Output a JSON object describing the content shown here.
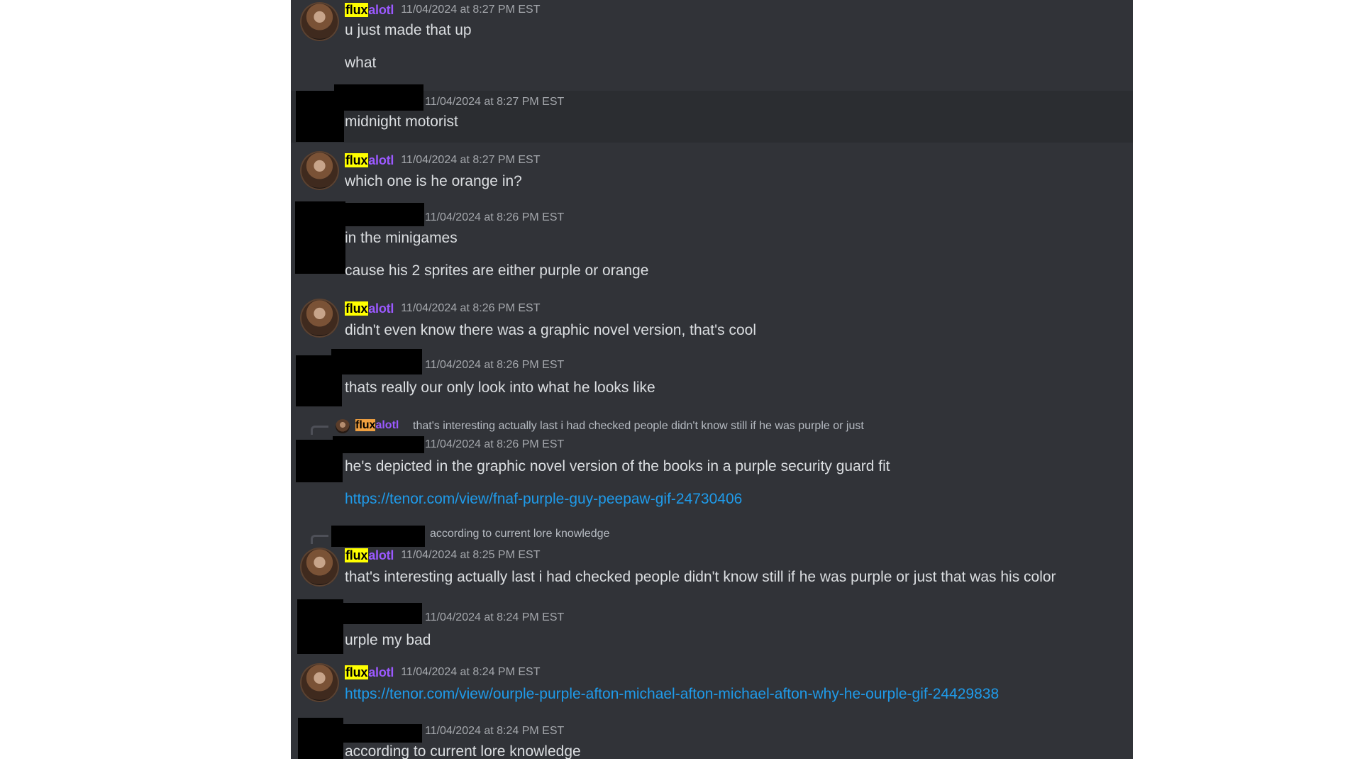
{
  "messages": [
    {
      "author_a": "flux",
      "author_b": "alotl",
      "time": "11/04/2024 at 8:27 PM EST",
      "lines": [
        "u just made that up",
        "what"
      ]
    },
    {
      "time": "11/04/2024 at 8:27 PM EST",
      "lines": [
        "midnight motorist"
      ]
    },
    {
      "author_a": "flux",
      "author_b": "alotl",
      "time": "11/04/2024 at 8:27 PM EST",
      "lines": [
        "which one is he orange in?"
      ]
    },
    {
      "time": "11/04/2024 at 8:26 PM EST",
      "lines": [
        "in the minigames",
        "cause his 2 sprites are either purple or orange"
      ]
    },
    {
      "author_a": "flux",
      "author_b": "alotl",
      "time": "11/04/2024 at 8:26 PM EST",
      "lines": [
        "didn't even know there was a graphic novel version, that's cool"
      ]
    },
    {
      "time": "11/04/2024 at 8:26 PM EST",
      "lines": [
        "thats really our only look into what he looks like"
      ]
    },
    {
      "reply": {
        "author_a": "flux",
        "author_b": "alotl",
        "text": "that's interesting actually last i had checked people didn't know still if he was purple or just"
      },
      "time": "11/04/2024 at 8:26 PM EST",
      "lines": [
        "he's depicted in the graphic novel version of the books in a purple security guard fit"
      ],
      "link": "https://tenor.com/view/fnaf-purple-guy-peepaw-gif-24730406"
    },
    {
      "reply": {
        "text": "according to current lore knowledge"
      },
      "author_a": "flux",
      "author_b": "alotl",
      "time": "11/04/2024 at 8:25 PM EST",
      "lines": [
        "that's interesting actually last i had checked people didn't know still if he was purple or just that was his color"
      ]
    },
    {
      "time": "11/04/2024 at 8:24 PM EST",
      "lines": [
        "urple my bad"
      ]
    },
    {
      "author_a": "flux",
      "author_b": "alotl",
      "time": "11/04/2024 at 8:24 PM EST",
      "link": "https://tenor.com/view/ourple-purple-afton-michael-afton-michael-afton-why-he-ourple-gif-24429838"
    },
    {
      "time": "11/04/2024 at 8:24 PM EST",
      "lines": [
        "according to current lore knowledge"
      ]
    }
  ]
}
